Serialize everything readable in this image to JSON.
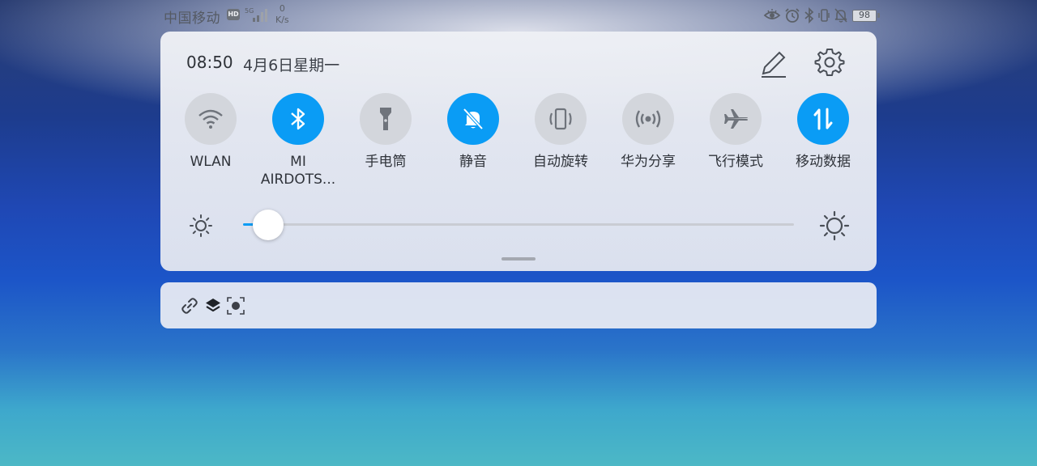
{
  "status_bar": {
    "carrier": "中国移动",
    "hd_badge": "HD",
    "network": "5G",
    "speed_value": "0",
    "speed_unit": "K/s",
    "battery": "98",
    "icons": [
      "eye-comfort-icon",
      "alarm-icon",
      "bluetooth-icon",
      "vibrate-icon",
      "mute-icon"
    ]
  },
  "panel": {
    "time": "08:50",
    "date": "4月6日星期一",
    "tiles": [
      {
        "label": "WLAN",
        "icon": "wifi-icon",
        "active": false
      },
      {
        "label": "MI AIRDOTS...",
        "icon": "bluetooth-icon",
        "active": true
      },
      {
        "label": "手电筒",
        "icon": "flashlight-icon",
        "active": false
      },
      {
        "label": "静音",
        "icon": "mute-bell-icon",
        "active": true
      },
      {
        "label": "自动旋转",
        "icon": "auto-rotate-icon",
        "active": false
      },
      {
        "label": "华为分享",
        "icon": "huawei-share-icon",
        "active": false
      },
      {
        "label": "飞行模式",
        "icon": "airplane-icon",
        "active": false
      },
      {
        "label": "移动数据",
        "icon": "mobile-data-icon",
        "active": true
      }
    ],
    "brightness_fraction": 0.045
  },
  "notification": {
    "icons": [
      "link-icon",
      "layers-icon",
      "screen-record-icon"
    ]
  },
  "colors": {
    "accent": "#0a9cf5",
    "tile_inactive": "#d3d6dc",
    "icon_inactive": "#6f747c"
  }
}
